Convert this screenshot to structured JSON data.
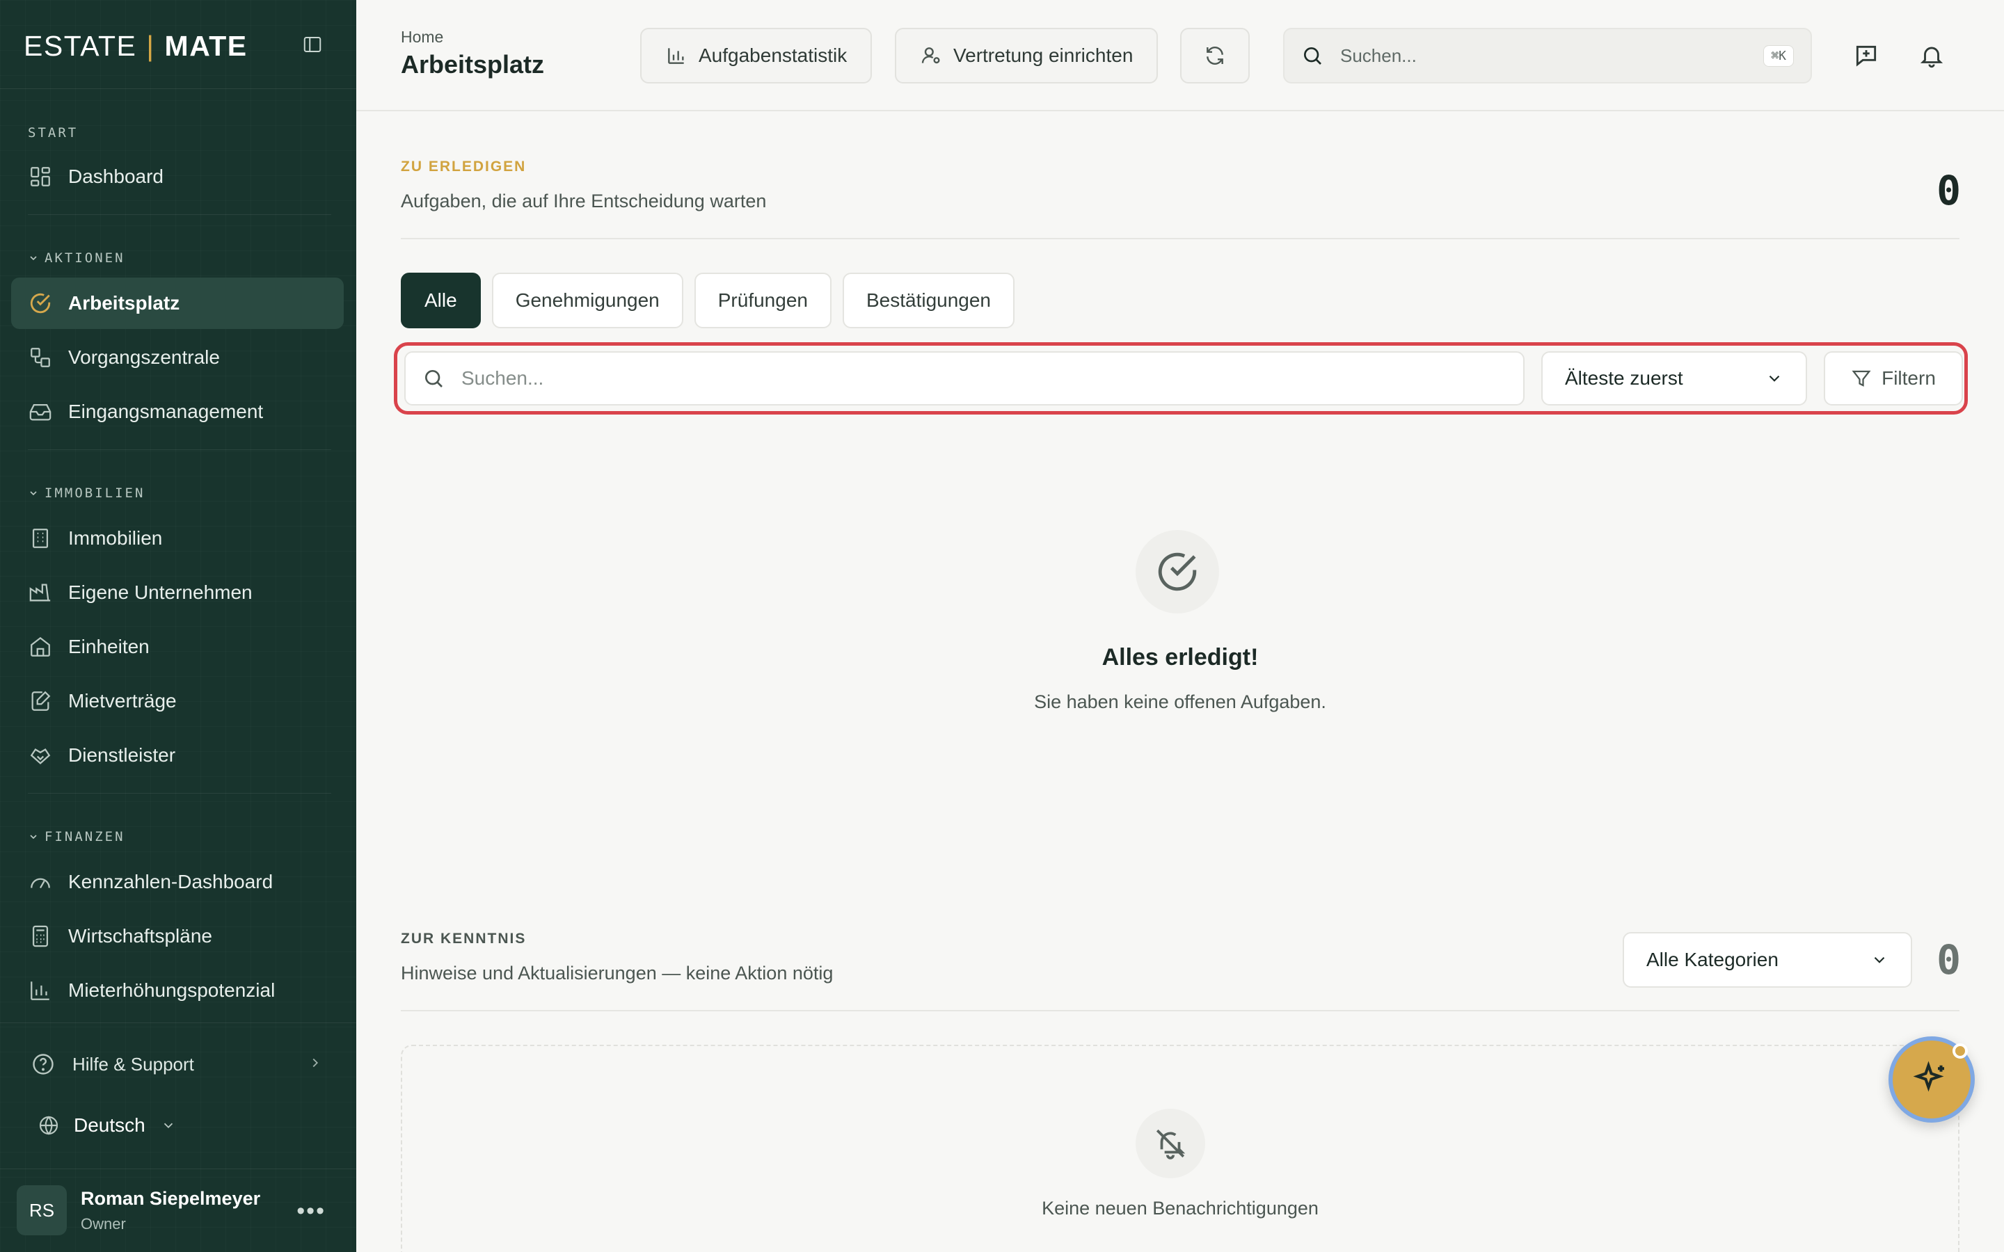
{
  "brand": {
    "word1": "ESTATE",
    "separator": "|",
    "word2": "MATE"
  },
  "sidebar": {
    "sections": {
      "start": "START",
      "aktionen": "AKTIONEN",
      "immobilien": "IMMOBILIEN",
      "finanzen": "FINANZEN"
    },
    "items": [
      {
        "label": "Dashboard",
        "icon": "grid-icon"
      },
      {
        "label": "Arbeitsplatz",
        "icon": "check-circle-icon",
        "active": true
      },
      {
        "label": "Vorgangszentrale",
        "icon": "workflow-icon"
      },
      {
        "label": "Eingangsmanagement",
        "icon": "inbox-icon"
      },
      {
        "label": "Immobilien",
        "icon": "building-icon"
      },
      {
        "label": "Eigene Unternehmen",
        "icon": "factory-icon"
      },
      {
        "label": "Einheiten",
        "icon": "home-icon"
      },
      {
        "label": "Mietverträge",
        "icon": "contract-icon"
      },
      {
        "label": "Dienstleister",
        "icon": "handshake-icon"
      },
      {
        "label": "Kennzahlen-Dashboard",
        "icon": "gauge-icon"
      },
      {
        "label": "Wirtschaftspläne",
        "icon": "calculator-icon"
      },
      {
        "label": "Mieterhöhungspotenzial",
        "icon": "bar-chart-icon"
      }
    ],
    "help": "Hilfe & Support",
    "language": "Deutsch",
    "user": {
      "initials": "RS",
      "name": "Roman Siepelmeyer",
      "role": "Owner"
    }
  },
  "header": {
    "breadcrumb": "Home",
    "title": "Arbeitsplatz",
    "buttons": {
      "stats": "Aufgabenstatistik",
      "substitute": "Vertretung einrichten"
    },
    "search_placeholder": "Suchen...",
    "shortcut": "⌘K"
  },
  "todo": {
    "title": "ZU ERLEDIGEN",
    "description": "Aufgaben, die auf Ihre Entscheidung warten",
    "count": "0",
    "tabs": [
      "Alle",
      "Genehmigungen",
      "Prüfungen",
      "Bestätigungen"
    ],
    "search_placeholder": "Suchen...",
    "sort": "Älteste zuerst",
    "filter": "Filtern",
    "empty_title": "Alles erledigt!",
    "empty_text": "Sie haben keine offenen Aufgaben."
  },
  "info": {
    "title": "ZUR KENNTNIS",
    "description": "Hinweise und Aktualisierungen — keine Aktion nötig",
    "category": "Alle Kategorien",
    "count": "0",
    "empty_text": "Keine neuen Benachrichtigungen"
  },
  "colors": {
    "sidebar": "#18342d",
    "accent_gold": "#d6a84c",
    "highlight_red": "#d9434b"
  }
}
